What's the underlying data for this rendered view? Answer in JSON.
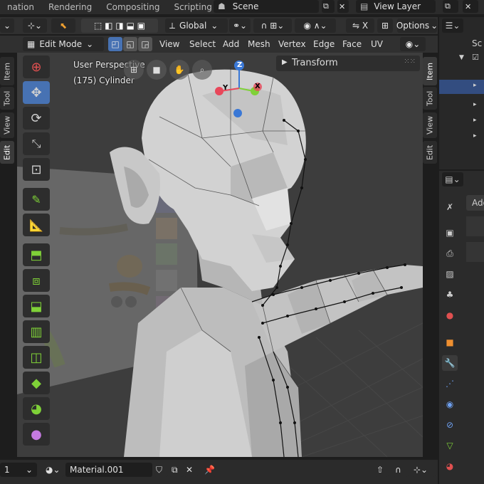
{
  "workspace_tabs": [
    "nation",
    "Rendering",
    "Compositing",
    "Scripting"
  ],
  "workspace_add": "+",
  "scene": "Scene",
  "view_layer": "View Layer",
  "header": {
    "transform_orientation": "Global",
    "options": "Options"
  },
  "mode": "Edit Mode",
  "menus": [
    "View",
    "Select",
    "Add",
    "Mesh",
    "Vertex",
    "Edge",
    "Face",
    "UV"
  ],
  "viewport": {
    "perspective": "User Perspective",
    "object_info": "(175) Cylinder",
    "axis_labels": {
      "z": "Z",
      "y": "Y",
      "x": "X"
    }
  },
  "npanel": {
    "title": "Transform"
  },
  "left_tabs": [
    "Item",
    "Tool",
    "View",
    "Edit"
  ],
  "right_tabs": [
    "Item",
    "Tool",
    "View",
    "Edit"
  ],
  "outliner_title": "Sc",
  "props_add": "Add",
  "bottom": {
    "frame": "1",
    "material": "Material.001"
  },
  "colors": {
    "accent_blue": "#4772b3",
    "axis_x": "#e8475a",
    "axis_y": "#7fd138",
    "axis_z": "#3a78d6",
    "mesh": "#c9c9c9"
  }
}
